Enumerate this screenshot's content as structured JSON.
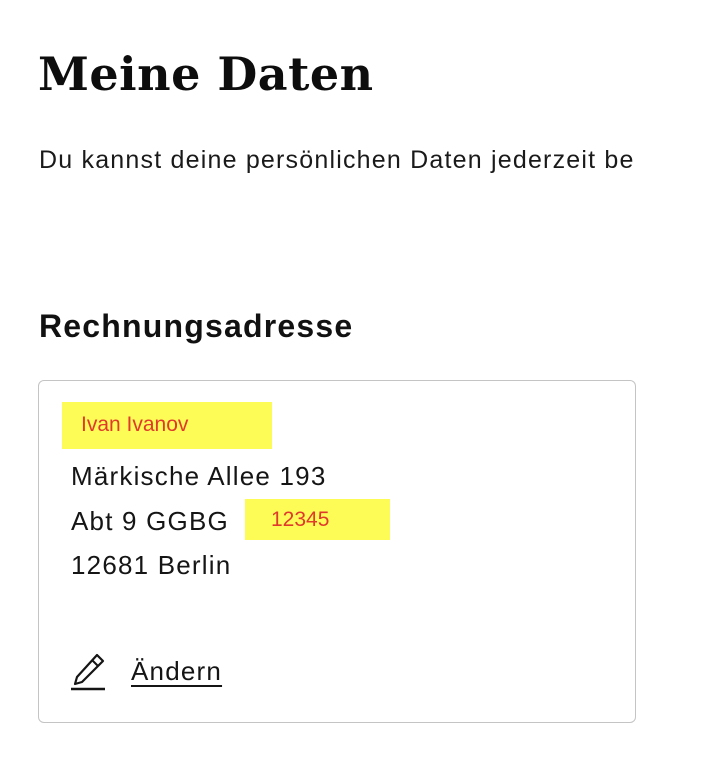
{
  "page": {
    "title": "Meine Daten",
    "intro": "Du kannst deine persönlichen Daten jederzeit be"
  },
  "billing_address": {
    "heading": "Rechnungsadresse",
    "name": "Ivan Ivanov",
    "street": "Märkische Allee 193",
    "line2": "Abt 9 GGBG",
    "line2_extra": "12345",
    "city": "12681 Berlin",
    "edit_label": "Ändern",
    "edit_icon": "pencil-icon"
  },
  "colors": {
    "highlight_background": "#fdfc57",
    "highlight_text": "#e03a2c",
    "card_border": "#c4c4c4",
    "text": "#111111"
  }
}
